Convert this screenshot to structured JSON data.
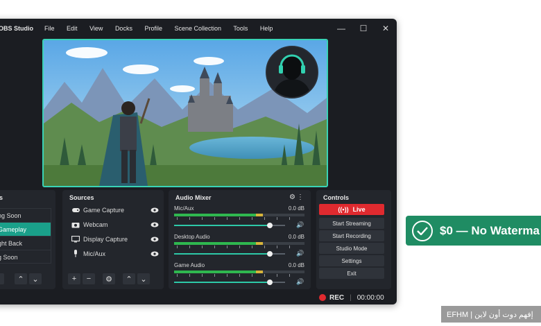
{
  "app": {
    "title": "OBS Studio"
  },
  "menu": [
    "File",
    "Edit",
    "View",
    "Docks",
    "Profile",
    "Scene Collection",
    "Tools",
    "Help"
  ],
  "window_controls": {
    "minimize": "—",
    "maximize": "☐",
    "close": "✕"
  },
  "panels": {
    "scenes": {
      "title": "es",
      "items": [
        "ng Soon",
        "Gameplay",
        "ght Back",
        "g Soon"
      ],
      "active_index": 1
    },
    "sources": {
      "title": "Sources",
      "items": [
        {
          "label": "Game Capture",
          "icon": "gamepad-icon"
        },
        {
          "label": "Webcam",
          "icon": "camera-icon"
        },
        {
          "label": "Display Capture",
          "icon": "monitor-icon"
        },
        {
          "label": "Mic/Aux",
          "icon": "microphone-icon"
        }
      ]
    },
    "mixer": {
      "title": "Audio Mixer",
      "channels": [
        {
          "name": "Mic/Aux",
          "db": "0.0 dB",
          "level": 0.86
        },
        {
          "name": "Desktop Audio",
          "db": "0.0 dB",
          "level": 0.86
        },
        {
          "name": "Game Audio",
          "db": "0.0 dB",
          "level": 0.86
        }
      ]
    },
    "controls": {
      "title": "Controls",
      "live": "Live",
      "buttons": [
        "Start Streaming",
        "Start Recording",
        "Studio Mode",
        "Settings",
        "Exit"
      ]
    }
  },
  "status": {
    "rec": "REC",
    "time": "00:00:00"
  },
  "badge": {
    "text": "$0 — No Waterma"
  },
  "watermark": {
    "text": "EFHM | إفهم دوت أون لاين"
  },
  "colors": {
    "accent": "#39d3b6",
    "live": "#e02a2f",
    "badge": "#1f8c63"
  }
}
